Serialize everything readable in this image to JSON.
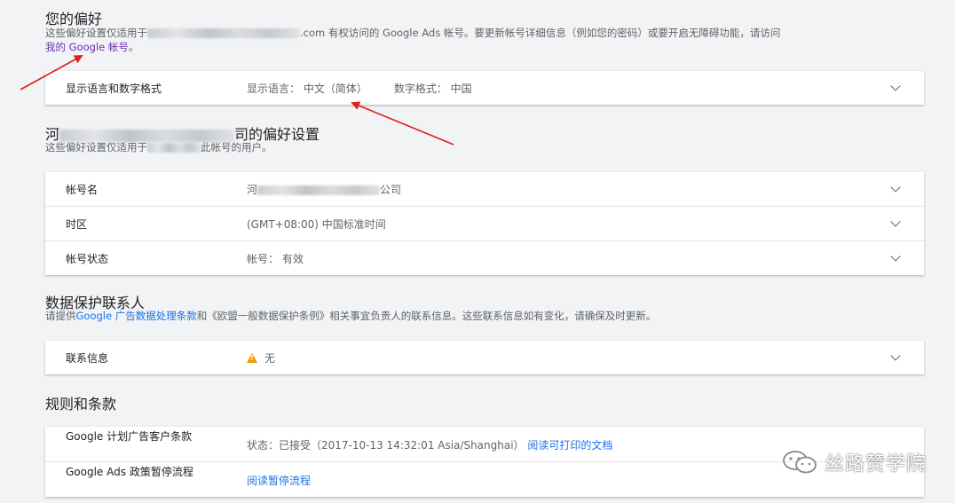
{
  "prefs": {
    "title": "您的偏好",
    "desc_prefix": "这些偏好设置仅适用于",
    "desc_suffix": ".com 有权访问的 Google Ads 帐号。要更新帐号详细信息（例如您的密码）或要开启无障碍功能，请访问",
    "link": "我的 Google 帐号",
    "link_end": "。",
    "row": {
      "label": "显示语言和数字格式",
      "value1": "显示语言： 中文（简体）",
      "value2": "数字格式： 中国"
    }
  },
  "company": {
    "title_prefix": "河",
    "title_suffix": "司的偏好设置",
    "desc_prefix": "这些偏好设置仅适用于",
    "desc_suffix": "此帐号的用户。",
    "rows": [
      {
        "label": "帐号名",
        "value_prefix": "河",
        "value_suffix": "公司"
      },
      {
        "label": "时区",
        "value": "(GMT+08:00) 中国标准时间"
      },
      {
        "label": "帐号状态",
        "value": "帐号： 有效"
      }
    ]
  },
  "dataprotection": {
    "title": "数据保护联系人",
    "desc_prefix": "请提供",
    "desc_link": "Google 广告数据处理条款",
    "desc_suffix": "和《欧盟一般数据保护条例》相关事宜负责人的联系信息。这些联系信息如有变化，请确保及时更新。",
    "row": {
      "label": "联系信息",
      "value": "无"
    }
  },
  "terms": {
    "title": "规则和条款",
    "rows": [
      {
        "label": "Google 计划广告客户条款",
        "value": "状态：已接受（2017-10-13 14:32:01 Asia/Shanghai）",
        "link": "阅读可打印的文档"
      },
      {
        "label": "Google Ads 政策暂停流程",
        "link": "阅读暂停流程"
      }
    ]
  },
  "watermark": {
    "text": "丝路赞学院"
  },
  "colors": {
    "link": "#1a73e8",
    "visited_link": "#6a2fb3",
    "warning": "#f29900",
    "arrow": "#e0201b",
    "background": "#f1f3f4"
  }
}
